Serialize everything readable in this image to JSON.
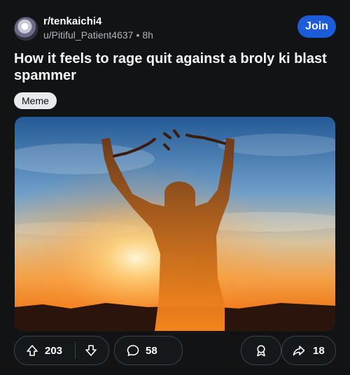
{
  "post": {
    "subreddit": "r/tenkaichi4",
    "author": "u/Pitiful_Patient4637",
    "separator": "•",
    "time": "8h",
    "join_label": "Join",
    "title": "How it feels to rage quit against a broly ki blast spammer",
    "flair": "Meme",
    "image_icon": "silhouette-broken-chains-image"
  },
  "actions": {
    "upvotes": "203",
    "comments": "58",
    "shares": "18"
  }
}
